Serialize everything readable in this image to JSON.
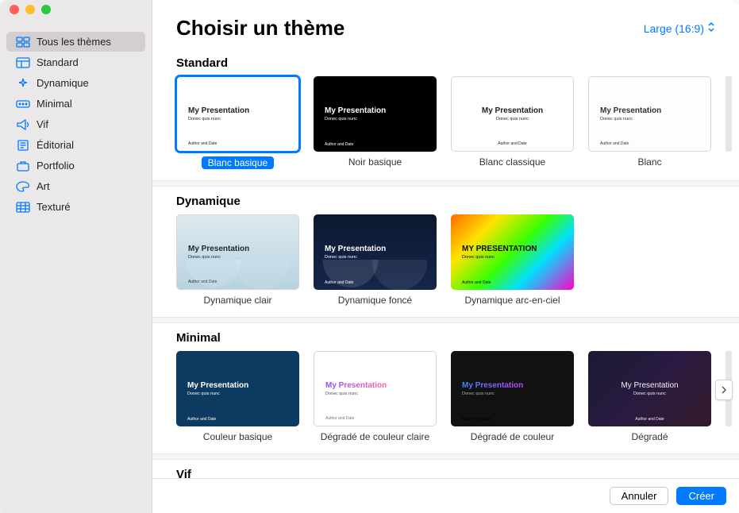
{
  "window": {
    "traffic": [
      "close",
      "minimize",
      "zoom"
    ]
  },
  "sidebar": {
    "items": [
      {
        "label": "Tous les thèmes",
        "active": true,
        "icon": "grid"
      },
      {
        "label": "Standard",
        "active": false,
        "icon": "layout"
      },
      {
        "label": "Dynamique",
        "active": false,
        "icon": "sparkle"
      },
      {
        "label": "Minimal",
        "active": false,
        "icon": "dots"
      },
      {
        "label": "Vif",
        "active": false,
        "icon": "megaphone"
      },
      {
        "label": "Éditorial",
        "active": false,
        "icon": "document"
      },
      {
        "label": "Portfolio",
        "active": false,
        "icon": "briefcase"
      },
      {
        "label": "Art",
        "active": false,
        "icon": "palette"
      },
      {
        "label": "Texturé",
        "active": false,
        "icon": "texture"
      }
    ]
  },
  "header": {
    "title": "Choisir un thème",
    "size_label": "Large (16:9)"
  },
  "preview_text": {
    "title": "My Presentation",
    "subtitle": "Donec quis nunc",
    "author": "Author and Date",
    "title_upper": "MY PRESENTATION"
  },
  "sections": [
    {
      "title": "Standard",
      "overflow_indicator": true,
      "themes": [
        {
          "label": "Blanc basique",
          "selected": true,
          "style": "bg-white"
        },
        {
          "label": "Noir basique",
          "selected": false,
          "style": "bg-black"
        },
        {
          "label": "Blanc classique",
          "selected": false,
          "style": "bg-classic center"
        },
        {
          "label": "Blanc",
          "selected": false,
          "style": "bg-blank"
        }
      ]
    },
    {
      "title": "Dynamique",
      "overflow_indicator": false,
      "themes": [
        {
          "label": "Dynamique clair",
          "selected": false,
          "style": "bg-dyn-light waves"
        },
        {
          "label": "Dynamique foncé",
          "selected": false,
          "style": "bg-dyn-dark waves"
        },
        {
          "label": "Dynamique arc-en-ciel",
          "selected": false,
          "style": "bg-rainbow",
          "upper": true
        }
      ]
    },
    {
      "title": "Minimal",
      "overflow_indicator": true,
      "right_arrow": true,
      "themes": [
        {
          "label": "Couleur basique",
          "selected": false,
          "style": "bg-navy"
        },
        {
          "label": "Dégradé de couleur claire",
          "selected": false,
          "style": "bg-grad-light"
        },
        {
          "label": "Dégradé de couleur",
          "selected": false,
          "style": "bg-grad-color"
        },
        {
          "label": "Dégradé",
          "selected": false,
          "style": "bg-grad-dark center"
        }
      ]
    },
    {
      "title": "Vif",
      "overflow_indicator": false,
      "themes": []
    }
  ],
  "footer": {
    "cancel": "Annuler",
    "create": "Créer"
  }
}
